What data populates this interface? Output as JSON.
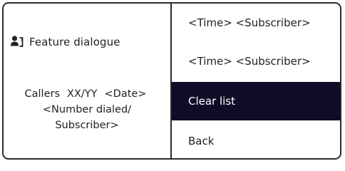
{
  "feature": {
    "icon": "person-key-icon",
    "title": "Feature dialogue"
  },
  "call_info": {
    "label": "Callers",
    "count": "XX/YY",
    "date": "<Date>",
    "number_line1": "<Number dialed/",
    "number_line2": "Subscriber>"
  },
  "menu": {
    "items": [
      {
        "label": "<Time> <Subscriber>"
      },
      {
        "label": "<Time> <Subscriber>"
      },
      {
        "label": "Clear list",
        "selected": true
      },
      {
        "label": "Back"
      }
    ]
  },
  "colors": {
    "selection_background": "#0e0c26",
    "border": "#2b2b2b"
  }
}
